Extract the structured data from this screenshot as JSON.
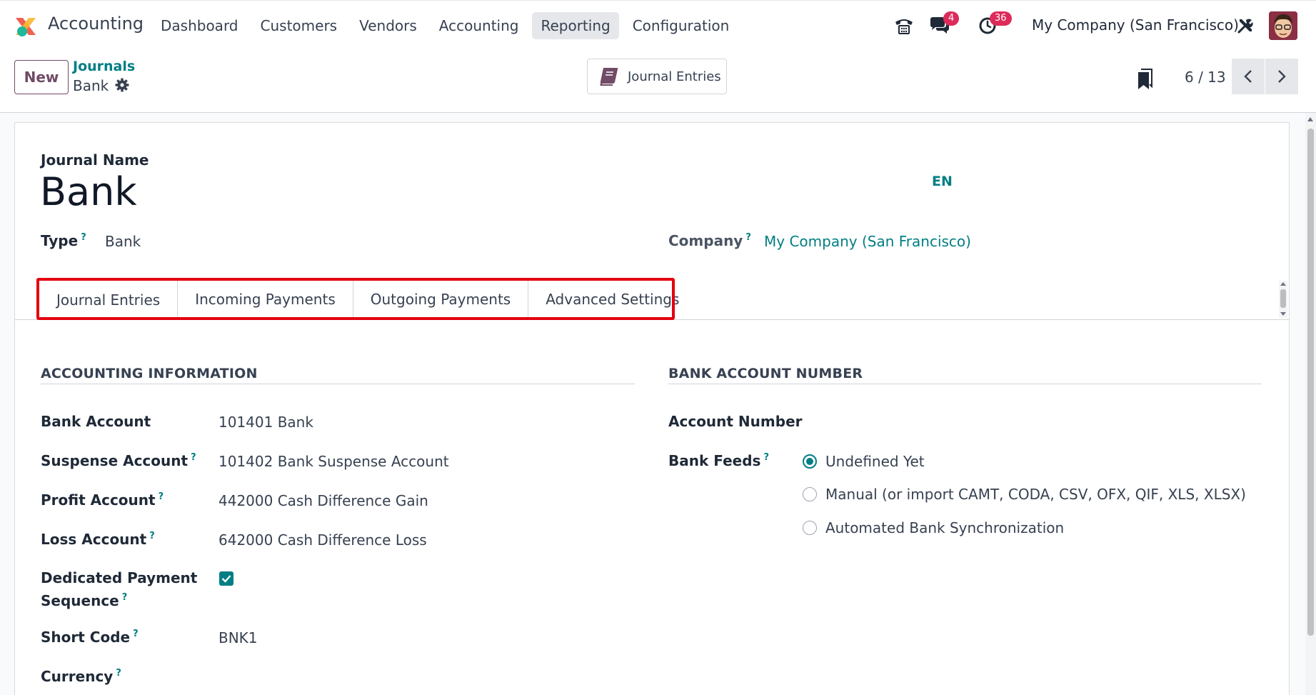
{
  "navbar": {
    "app_name": "Accounting",
    "menu": [
      "Dashboard",
      "Customers",
      "Vendors",
      "Accounting",
      "Reporting",
      "Configuration"
    ],
    "active_menu": "Reporting",
    "icons": [
      "phone-icon",
      "chat-icon",
      "activity-clock-icon",
      "tools-icon"
    ],
    "chat_badge": "4",
    "activity_badge": "36",
    "company": "My Company (San Francisco)"
  },
  "control_panel": {
    "new_label": "New",
    "breadcrumb_parent": "Journals",
    "breadcrumb_current": "Bank",
    "smart_button_label": "Journal Entries",
    "pager_value": "6 / 13"
  },
  "form": {
    "journal_name_label": "Journal Name",
    "journal_name": "Bank",
    "lang": "EN",
    "type_label": "Type",
    "type_value": "Bank",
    "company_label": "Company",
    "company_value": "My Company (San Francisco)",
    "help_mark": "?"
  },
  "tabs": [
    "Journal Entries",
    "Incoming Payments",
    "Outgoing Payments",
    "Advanced Settings"
  ],
  "accounting_info": {
    "title": "ACCOUNTING INFORMATION",
    "bank_account_label": "Bank Account",
    "bank_account_value": "101401 Bank",
    "suspense_label": "Suspense Account",
    "suspense_value": "101402 Bank Suspense Account",
    "profit_label": "Profit Account",
    "profit_value": "442000 Cash Difference Gain",
    "loss_label": "Loss Account",
    "loss_value": "642000 Cash Difference Loss",
    "dedicated_label_1": "Dedicated Payment",
    "dedicated_label_2": "Sequence",
    "dedicated_checked": true,
    "short_code_label": "Short Code",
    "short_code_value": "BNK1",
    "currency_label": "Currency"
  },
  "bank_account_number": {
    "title": "BANK ACCOUNT NUMBER",
    "account_number_label": "Account Number",
    "bank_feeds_label": "Bank Feeds",
    "options": [
      "Undefined Yet",
      "Manual (or import CAMT, CODA, CSV, OFX, QIF, XLS, XLSX)",
      "Automated Bank Synchronization"
    ],
    "selected": "Undefined Yet"
  },
  "colors": {
    "brand": "#714b67",
    "accent": "#017e84",
    "badge": "#dc2b5a",
    "highlight": "#e3000f"
  }
}
